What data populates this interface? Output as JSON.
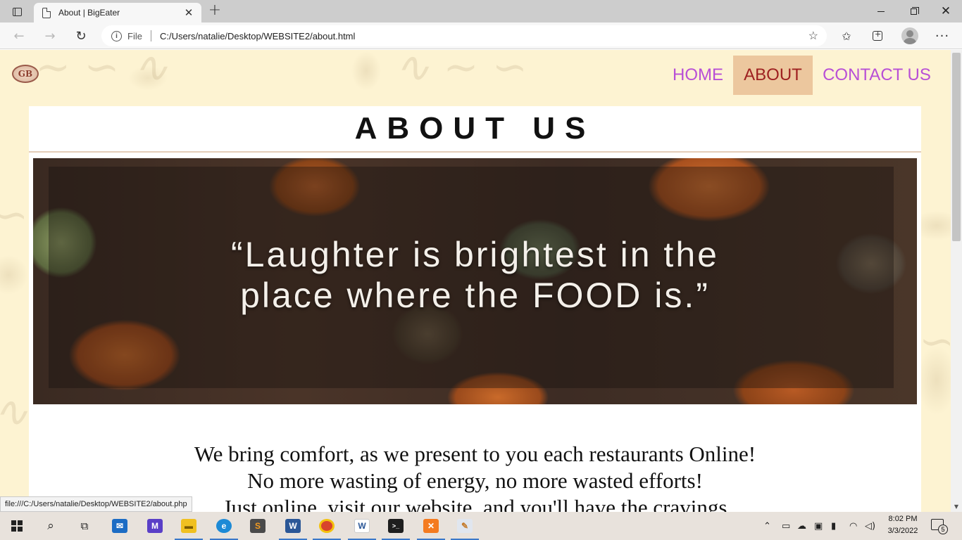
{
  "browser": {
    "tab_title": "About | BigEater",
    "url_scheme": "File",
    "url": "C:/Users/natalie/Desktop/WEBSITE2/about.html",
    "status_url": "file:///C:/Users/natalie/Desktop/WEBSITE2/about.php"
  },
  "site": {
    "logo_text": "GB",
    "nav": {
      "home": "HOME",
      "about": "ABOUT",
      "contact": "CONTACT US"
    },
    "heading": "ABOUT US",
    "hero_quote_line1": "“Laughter is brightest in the",
    "hero_quote_line2": "place where the FOOD is.”",
    "body_lines": [
      "We bring comfort, as we present to you each restaurants Online!",
      "No more wasting of energy, no more wasted efforts!",
      "Just online, visit our website, and you'll have the cravings"
    ]
  },
  "colors": {
    "page_bg": "#fdf3d2",
    "nav_link": "#b84fd6",
    "nav_active_bg": "#ecc79e",
    "nav_active_text": "#9e2020"
  },
  "taskbar": {
    "time": "8:02 PM",
    "date": "3/3/2022",
    "notification_count": "5",
    "apps": [
      "search-icon",
      "task-view-icon",
      "mail-icon",
      "visual-studio-icon",
      "file-explorer-icon",
      "edge-icon",
      "sublime-text-icon",
      "word-icon",
      "chrome-icon",
      "word-document-icon",
      "terminal-icon",
      "xampp-icon",
      "paint-icon"
    ]
  }
}
